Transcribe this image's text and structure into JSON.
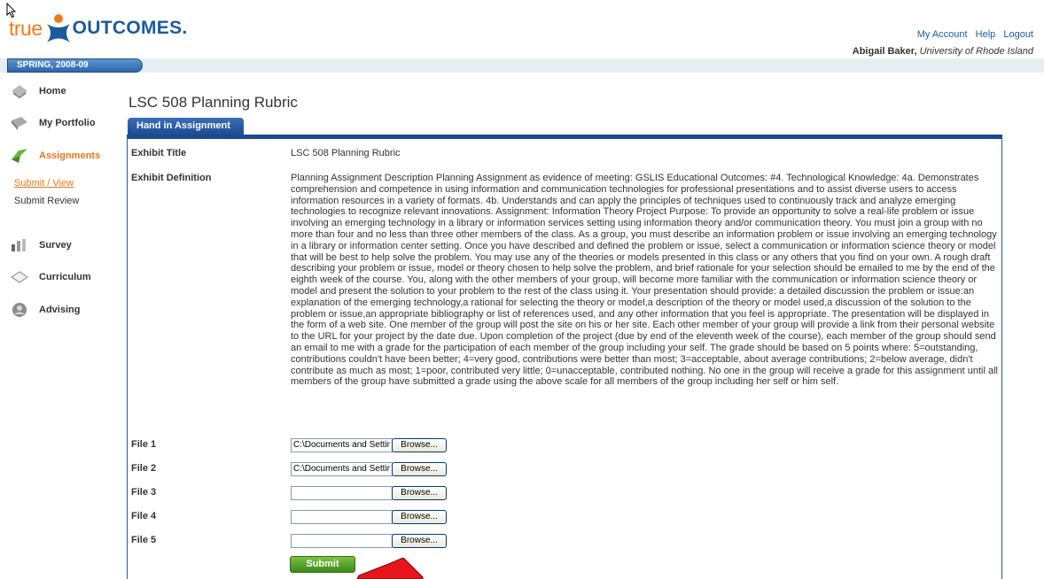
{
  "header": {
    "logo_true": "true",
    "logo_outcomes": "OUTCOMES.",
    "links": [
      "My Account",
      "Help",
      "Logout"
    ],
    "user_name": "Abigail Baker,",
    "institution": "University of Rhode Island"
  },
  "term": "SPRING, 2008-09",
  "sidebar": {
    "items": [
      {
        "label": "Home",
        "icon": "home-icon"
      },
      {
        "label": "My Portfolio",
        "icon": "portfolio-icon"
      },
      {
        "label": "Assignments",
        "icon": "assignments-icon"
      },
      {
        "label": "Survey",
        "icon": "survey-icon"
      },
      {
        "label": "Curriculum",
        "icon": "curriculum-icon"
      },
      {
        "label": "Advising",
        "icon": "advising-icon"
      }
    ],
    "sub_items": [
      {
        "label": "Submit / View"
      },
      {
        "label": "Submit Review"
      }
    ]
  },
  "main": {
    "title": "LSC 508 Planning Rubric",
    "tab_label": "Hand in Assignment",
    "exhibit_title_label": "Exhibit Title",
    "exhibit_title_value": "LSC 508 Planning Rubric",
    "exhibit_definition_label": "Exhibit Definition",
    "exhibit_definition": "Planning Assignment Description Planning Assignment as evidence of meeting: GSLIS Educational Outcomes: #4. Technological Knowledge: 4a. Demonstrates comprehension and competence in using information and communication technologies for professional presentations and to assist diverse users to access information resources in a variety of formats. 4b. Understands and can apply the principles of techniques used to continuously track and analyze emerging technologies to recognize relevant innovations. Assignment: Information Theory Project Purpose: To provide an opportunity to solve a real-life problem or issue involving an emerging technology in a library or information services setting using information theory and/or communication theory. You must join a group with no more than four and no less than three other members of the class. As a group, you must describe an information problem or issue involving an emerging technology in a library or information center setting. Once you have described and defined the problem or issue, select a communication or information science theory or model that will be best to help solve the problem. You may use any of the theories or models presented in this class or any others that you find on your own. A rough draft describing your problem or issue, model or theory chosen to help solve the problem, and brief rationale for your selection should be emailed to me by the end of the eighth week of the course. You, along with the other members of your group, will become more familiar with the communication or information science theory or model and present the solution to your problem to the rest of the class using it. Your presentation should provide: a detailed discussion the problem or issue:an explanation of the emerging technology,a rational for selecting the theory or model,a description of the theory or model used,a discussion of the solution to the problem or issue,an appropriate bibliography or list of references used, and any other information that you feel is appropriate. The presentation will be displayed in the form of a web site. One member of the group will post the site on his or her site. Each other member of your group will provide a link from their personal website to the URL for your project by the date due. Upon completion of the project (due by end of the eleventh week of the course), each member of the group should send an email to me with a grade for the participation of each member of the group including your self. The grade should be based on 5 points where: 5=outstanding, contributions couldn't have been better; 4=very good, contributions were better than most; 3=acceptable, about average contributions; 2=below average, didn't contribute as much as most; 1=poor, contributed very little; 0=unacceptable, contributed nothing. No one in the group will receive a grade for this assignment until all members of the group have submitted a grade using the above scale for all members of the group including her self or him self.",
    "files": [
      {
        "label": "File 1",
        "value": "C:\\Documents and Settir"
      },
      {
        "label": "File 2",
        "value": "C:\\Documents and Settir"
      },
      {
        "label": "File 3",
        "value": ""
      },
      {
        "label": "File 4",
        "value": ""
      },
      {
        "label": "File 5",
        "value": ""
      }
    ],
    "browse_label": "Browse...",
    "submit_label": "Submit"
  },
  "colors": {
    "brand_orange": "#f07a1a",
    "brand_blue": "#1c5a9e",
    "panel_border": "#1a4a8e",
    "submit_green": "#4c9a22",
    "annotation_arrow": "#e8141c"
  }
}
